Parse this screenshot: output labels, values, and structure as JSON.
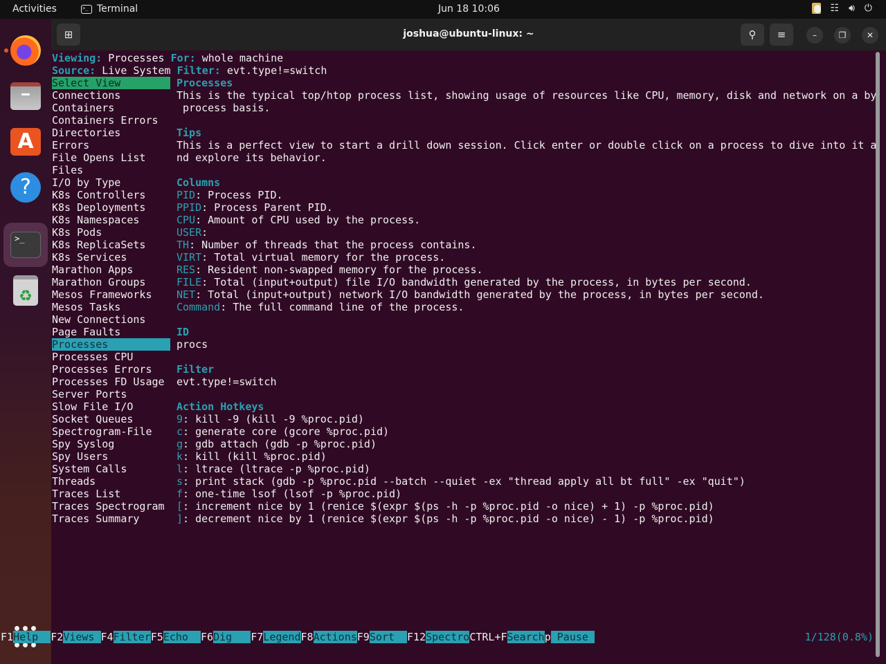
{
  "system_bar": {
    "activities": "Activities",
    "app_name": "Terminal",
    "clock": "Jun 18  10:06",
    "tray_icons": [
      "clipboard-icon",
      "network-icon",
      "volume-icon",
      "power-icon"
    ]
  },
  "dock": {
    "items": [
      {
        "name": "firefox",
        "icon": "firefox-icon",
        "running": true,
        "active": false
      },
      {
        "name": "files",
        "icon": "files-icon",
        "running": false,
        "active": false
      },
      {
        "name": "app-center",
        "icon": "app-center-icon",
        "running": false,
        "active": false
      },
      {
        "name": "help",
        "icon": "help-icon",
        "running": false,
        "active": false
      },
      {
        "name": "terminal",
        "icon": "terminal-icon",
        "running": true,
        "active": true
      },
      {
        "name": "trash",
        "icon": "trash-icon",
        "running": false,
        "active": false
      }
    ],
    "show_apps_icon": "show-apps-icon"
  },
  "window": {
    "title": "joshua@ubuntu-linux: ~",
    "new_tab_icon": "new-tab-icon",
    "search_icon": "search-icon",
    "menu_icon": "hamburger-menu-icon",
    "minimize_icon": "minimize-icon",
    "maximize_icon": "restore-icon",
    "close_icon": "close-icon"
  },
  "header": {
    "viewing_label": "Viewing:",
    "viewing_value": "Processes",
    "for_label": "For:",
    "for_value": "whole machine",
    "source_label": "Source:",
    "source_value": "Live System",
    "filter_label": "Filter:",
    "filter_value": "evt.type!=switch"
  },
  "views": {
    "title": "Select View",
    "selected": "Processes",
    "items": [
      "Connections",
      "Containers",
      "Containers Errors",
      "Directories",
      "Errors",
      "File Opens List",
      "Files",
      "I/O by Type",
      "K8s Controllers",
      "K8s Deployments",
      "K8s Namespaces",
      "K8s Pods",
      "K8s ReplicaSets",
      "K8s Services",
      "Marathon Apps",
      "Marathon Groups",
      "Mesos Frameworks",
      "Mesos Tasks",
      "New Connections",
      "Page Faults",
      "Processes",
      "Processes CPU",
      "Processes Errors",
      "Processes FD Usage",
      "Server Ports",
      "Slow File I/O",
      "Socket Queues",
      "Spectrogram-File",
      "Spy Syslog",
      "Spy Users",
      "System Calls",
      "Threads",
      "Traces List",
      "Traces Spectrogram",
      "Traces Summary"
    ]
  },
  "detail": {
    "title": "Processes",
    "description_lines": [
      "This is the typical top/htop process list, showing usage of resources like CPU, memory, disk and network on a by",
      " process basis."
    ],
    "tips_heading": "Tips",
    "tips_lines": [
      "This is a perfect view to start a drill down session. Click enter or double click on a process to dive into it a",
      "nd explore its behavior."
    ],
    "columns_heading": "Columns",
    "columns": [
      {
        "name": "PID",
        "desc": "Process PID."
      },
      {
        "name": "PPID",
        "desc": "Process Parent PID."
      },
      {
        "name": "CPU",
        "desc": "Amount of CPU used by the process."
      },
      {
        "name": "USER",
        "desc": ""
      },
      {
        "name": "TH",
        "desc": "Number of threads that the process contains."
      },
      {
        "name": "VIRT",
        "desc": "Total virtual memory for the process."
      },
      {
        "name": "RES",
        "desc": "Resident non-swapped memory for the process."
      },
      {
        "name": "FILE",
        "desc": "Total (input+output) file I/O bandwidth generated by the process, in bytes per second."
      },
      {
        "name": "NET",
        "desc": "Total (input+output) network I/O bandwidth generated by the process, in bytes per second."
      },
      {
        "name": "Command",
        "desc": "The full command line of the process."
      }
    ],
    "id_heading": "ID",
    "id_value": "procs",
    "filter_heading": "Filter",
    "filter_value": "evt.type!=switch",
    "hotkeys_heading": "Action Hotkeys",
    "hotkeys": [
      {
        "key": "9",
        "desc": "kill -9 (kill -9 %proc.pid)"
      },
      {
        "key": "c",
        "desc": "generate core (gcore %proc.pid)"
      },
      {
        "key": "g",
        "desc": "gdb attach (gdb -p %proc.pid)"
      },
      {
        "key": "k",
        "desc": "kill (kill %proc.pid)"
      },
      {
        "key": "l",
        "desc": "ltrace (ltrace -p %proc.pid)"
      },
      {
        "key": "s",
        "desc": "print stack (gdb -p %proc.pid --batch --quiet -ex \"thread apply all bt full\" -ex \"quit\")"
      },
      {
        "key": "f",
        "desc": "one-time lsof (lsof -p %proc.pid)"
      },
      {
        "key": "[",
        "desc": "increment nice by 1 (renice $(expr $(ps -h -p %proc.pid -o nice) + 1) -p %proc.pid)"
      },
      {
        "key": "]",
        "desc": "decrement nice by 1 (renice $(expr $(ps -h -p %proc.pid -o nice) - 1) -p %proc.pid)"
      }
    ]
  },
  "function_keys": [
    {
      "key": "F1",
      "label": "Help  "
    },
    {
      "key": "F2",
      "label": "Views "
    },
    {
      "key": "F4",
      "label": "Filter"
    },
    {
      "key": "F5",
      "label": "Echo  "
    },
    {
      "key": "F6",
      "label": "Dig   "
    },
    {
      "key": "F7",
      "label": "Legend"
    },
    {
      "key": "F8",
      "label": "Actions"
    },
    {
      "key": "F9",
      "label": "Sort  "
    },
    {
      "key": "F12",
      "label": "Spectro"
    },
    {
      "key": "CTRL+F",
      "label": "Search"
    },
    {
      "key": "p",
      "label": " Pause "
    }
  ],
  "position": "1/128(0.8%)",
  "colors": {
    "terminal_bg": "#300a24",
    "accent_cyan": "#2aa1b3",
    "selection_green": "#26a269",
    "text": "#f0f0f0"
  }
}
